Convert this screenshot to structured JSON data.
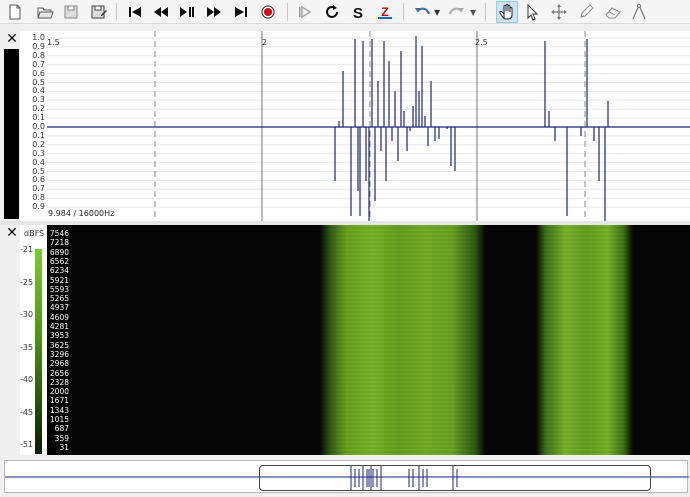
{
  "toolbar": {
    "buttons": [
      {
        "name": "new-file-button",
        "icon": "new-file-icon"
      },
      {
        "name": "open-button",
        "icon": "folder-icon"
      },
      {
        "name": "save-button",
        "icon": "save-icon"
      },
      {
        "name": "save-as-button",
        "icon": "save-as-icon"
      },
      {
        "name": "go-start-button",
        "icon": "skip-start-icon"
      },
      {
        "name": "rewind-button",
        "icon": "rewind-icon"
      },
      {
        "name": "play-pause-button",
        "icon": "play-pause-icon"
      },
      {
        "name": "fast-forward-button",
        "icon": "fast-forward-icon"
      },
      {
        "name": "go-end-button",
        "icon": "skip-end-icon"
      },
      {
        "name": "record-button",
        "icon": "record-icon"
      },
      {
        "name": "play-selection-button",
        "icon": "play-selection-icon"
      },
      {
        "name": "loop-button",
        "icon": "loop-icon"
      },
      {
        "name": "snap-button",
        "icon": "snap-icon"
      },
      {
        "name": "zoom-button",
        "icon": "zoom-icon"
      },
      {
        "name": "undo-button",
        "icon": "undo-icon"
      },
      {
        "name": "redo-button",
        "icon": "redo-icon"
      },
      {
        "name": "navigate-tool-button",
        "icon": "hand-icon"
      },
      {
        "name": "select-tool-button",
        "icon": "pointer-icon"
      },
      {
        "name": "move-tool-button",
        "icon": "move-icon"
      },
      {
        "name": "draw-tool-button",
        "icon": "pencil-icon"
      },
      {
        "name": "erase-tool-button",
        "icon": "eraser-icon"
      },
      {
        "name": "measure-tool-button",
        "icon": "measure-icon"
      }
    ],
    "active_tool": "navigate-tool-button"
  },
  "waveform": {
    "y_labels": [
      "1.0",
      "0.9",
      "0.8",
      "0.7",
      "0.6",
      "0.5",
      "0.4",
      "0.3",
      "0.2",
      "0.1",
      "0.0",
      "0.1",
      "0.2",
      "0.3",
      "0.4",
      "0.5",
      "0.6",
      "0.7",
      "0.8",
      "0.9"
    ],
    "x_ticks": [
      "1.5",
      "2",
      "2.5"
    ],
    "info": "9.984 / 16000Hz",
    "colors": {
      "wave": "#1a237e",
      "grid": "#e8e8e8"
    }
  },
  "spectrogram": {
    "db_unit": "dBFS",
    "db_labels": [
      "-21",
      "-25",
      "-30",
      "-35",
      "-40",
      "-45",
      "-51"
    ],
    "freq_labels": [
      "7546",
      "7218",
      "6890",
      "6562",
      "6234",
      "5921",
      "5593",
      "5265",
      "4937",
      "4609",
      "4281",
      "3953",
      "3625",
      "3296",
      "2968",
      "2656",
      "2328",
      "2000",
      "1671",
      "1343",
      "1015",
      "687",
      "359",
      "31"
    ],
    "colors": {
      "band": "#6fae22",
      "background": "#050505"
    }
  }
}
